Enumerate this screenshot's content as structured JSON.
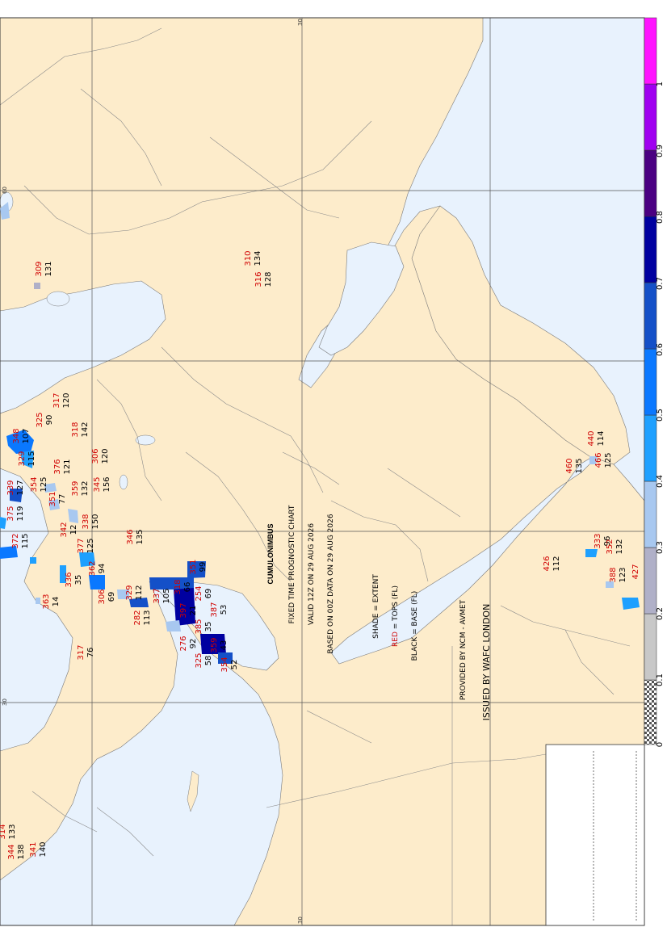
{
  "info": {
    "title": "CUMULONIMBUS",
    "line1": "FIXED TIME PROGNOSTIC CHART",
    "line2": "VALID 12Z ON 29 AUG 2026",
    "line3": "BASED ON 00Z DATA ON 29 AUG 2026",
    "key1": "SHADE = EXTENT",
    "key2_red": "RED",
    "key2_rest": " = TOPS (FL)",
    "key3": "BLACK = BASE (FL)",
    "provider": "PROVIDED BY NCM - AVMET",
    "issuer": "ISSUED BY WAFC LONDON"
  },
  "grid_labels": [
    "30",
    "60",
    "30",
    "30"
  ],
  "legend": {
    "ticks": [
      "0",
      "0.1",
      "0.2",
      "0.3",
      "0.4",
      "0.5",
      "0.6",
      "0.7",
      "0.8",
      "0.9",
      "1"
    ],
    "colors": [
      "#c8c8c8",
      "#b0b0c8",
      "#a8c8f0",
      "#1ea0ff",
      "#0a78ff",
      "#1450c8",
      "#0000a0",
      "#4b0082",
      "#a000f0",
      "#ff14ff"
    ]
  },
  "colors": {
    "land": "#fdeccb",
    "sea": "#e8f2fd",
    "tops": "#d00000",
    "base": "#000000",
    "grid": "#555555"
  },
  "cells": [
    {
      "top": "310",
      "base": "134"
    },
    {
      "top": "316",
      "base": "128"
    },
    {
      "top": "309",
      "base": "131"
    },
    {
      "top": "317",
      "base": "120"
    },
    {
      "top": "348",
      "base": "107"
    },
    {
      "top": "325",
      "base": "90"
    },
    {
      "top": "318",
      "base": "142"
    },
    {
      "top": "329",
      "base": "115"
    },
    {
      "top": "376",
      "base": "121"
    },
    {
      "top": "306",
      "base": "120"
    },
    {
      "top": "339",
      "base": "127"
    },
    {
      "top": "354",
      "base": "125"
    },
    {
      "top": "351",
      "base": "77"
    },
    {
      "top": "359",
      "base": "132"
    },
    {
      "top": "345",
      "base": "156"
    },
    {
      "top": "375",
      "base": "119"
    },
    {
      "top": "342",
      "base": "12"
    },
    {
      "top": "338",
      "base": "150"
    },
    {
      "top": "372",
      "base": "115"
    },
    {
      "top": "377",
      "base": "125"
    },
    {
      "top": "346",
      "base": "135"
    },
    {
      "top": "336",
      "base": "35"
    },
    {
      "top": "362",
      "base": "94"
    },
    {
      "top": "363",
      "base": "14"
    },
    {
      "top": "306",
      "base": "69"
    },
    {
      "top": "329",
      "base": "112"
    },
    {
      "top": "282",
      "base": "113"
    },
    {
      "top": "337",
      "base": "105"
    },
    {
      "top": "318",
      "base": "66"
    },
    {
      "top": "351",
      "base": "99"
    },
    {
      "top": "397",
      "base": "21"
    },
    {
      "top": "254",
      "base": "69"
    },
    {
      "top": "387",
      "base": "53"
    },
    {
      "top": "276",
      "base": "92"
    },
    {
      "top": "385",
      "base": "35"
    },
    {
      "top": "359",
      "base": "43"
    },
    {
      "top": "325",
      "base": "58"
    },
    {
      "top": "354",
      "base": "52"
    },
    {
      "top": "317",
      "base": "76"
    },
    {
      "top": "460",
      "base": "135"
    },
    {
      "top": "440",
      "base": "114"
    },
    {
      "top": "466",
      "base": "125"
    },
    {
      "top": "426",
      "base": "112"
    },
    {
      "top": "333",
      "base": "96"
    },
    {
      "top": "352",
      "base": "132"
    },
    {
      "top": "388",
      "base": "123"
    },
    {
      "top": "427",
      "base": ""
    },
    {
      "top": "314",
      "base": "133"
    },
    {
      "top": "344",
      "base": "138"
    },
    {
      "top": "341",
      "base": "140"
    }
  ]
}
